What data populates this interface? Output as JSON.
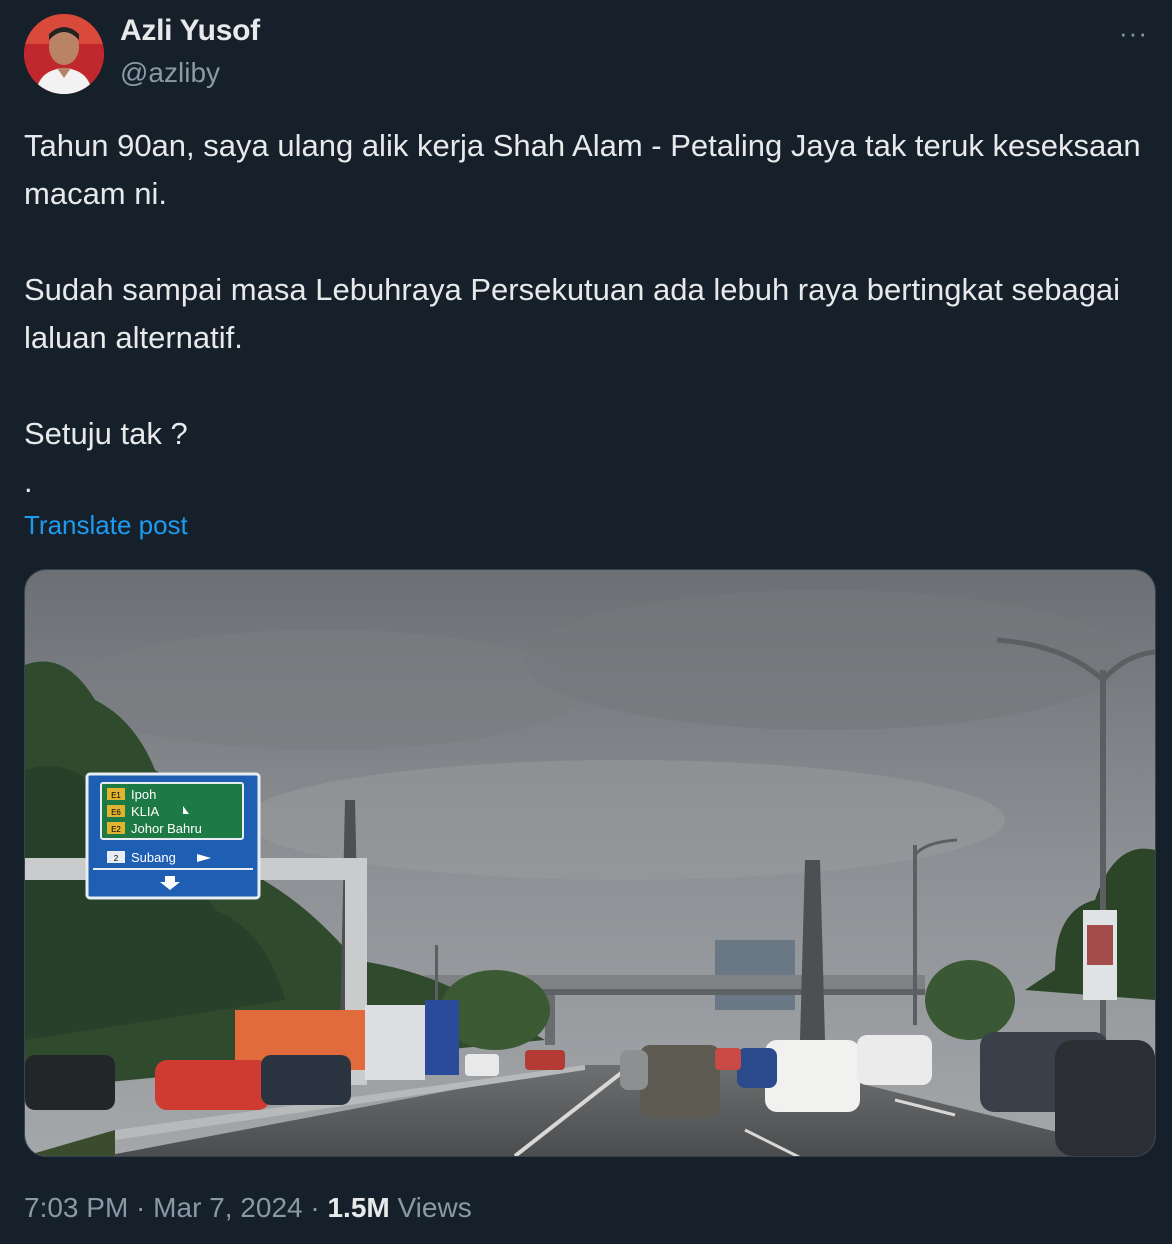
{
  "author": {
    "name": "Azli Yusof",
    "handle": "@azliby"
  },
  "more_label": "···",
  "tweet": {
    "lines": [
      "Tahun 90an, saya ulang alik kerja Shah Alam - Petaling Jaya tak teruk keseksaan macam ni.",
      "Sudah sampai masa Lebuhraya Persekutuan ada lebuh raya bertingkat sebagai laluan alternatif.",
      "Setuju tak ?",
      "."
    ]
  },
  "translate_label": "Translate post",
  "sign": {
    "row1": "Ipoh",
    "row2": "KLIA",
    "row3": "Johor Bahru",
    "row4": "Subang",
    "badge1": "E1",
    "badge2": "E6",
    "badge3": "E2",
    "badge4": "2"
  },
  "meta": {
    "time": "7:03 PM",
    "sep1": " · ",
    "date": "Mar 7, 2024",
    "sep2": " · ",
    "views_count": "1.5M",
    "views_label": " Views"
  },
  "colors": {
    "background": "#15202b",
    "link": "#1d9bf0",
    "muted": "#8b98a5",
    "sign_blue": "#1f5fb3",
    "sign_green": "#1e7a45"
  }
}
